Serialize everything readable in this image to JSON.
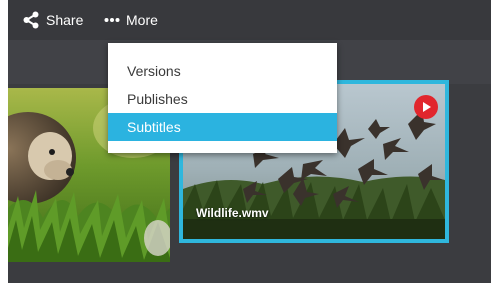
{
  "toolbar": {
    "share": {
      "label": "Share",
      "icon": "share-icon"
    },
    "more": {
      "label": "More",
      "icon": "ellipsis-icon"
    }
  },
  "more_menu": {
    "items": [
      {
        "label": "Versions",
        "selected": false
      },
      {
        "label": "Publishes",
        "selected": false
      },
      {
        "label": "Subtitles",
        "selected": true
      }
    ]
  },
  "media": [
    {
      "name": "",
      "thumbnail": "hedgehog-in-grass"
    },
    {
      "name": "Wildlife.wmv",
      "thumbnail": "birds-over-grass",
      "selected": true,
      "badge": "play-icon"
    }
  ],
  "colors": {
    "app_bg": "#3b3c40",
    "toolbar_bg": "#38393d",
    "accent": "#2bb3e0",
    "play_badge": "#e1262d"
  }
}
